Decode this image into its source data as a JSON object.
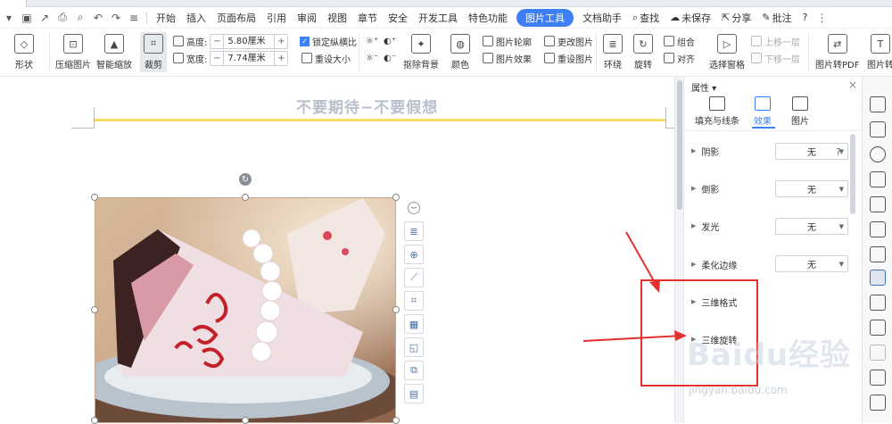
{
  "menubar": {
    "items": [
      "开始",
      "插入",
      "页面布局",
      "引用",
      "审阅",
      "视图",
      "章节",
      "安全",
      "开发工具",
      "特色功能",
      "图片工具",
      "文档助手"
    ],
    "active_tab": "图片工具",
    "search_label": "查找",
    "unsaved_label": "未保存",
    "share_label": "分享",
    "comment_label": "批注",
    "help_label": "?"
  },
  "ribbon": {
    "shape_label": "形状",
    "compress_label": "压缩图片",
    "smart_zoom_label": "智能缩放",
    "crop_label": "裁剪",
    "height_label": "高度:",
    "height_value": "5.80厘米",
    "width_label": "宽度:",
    "width_value": "7.74厘米",
    "lock_ratio_label": "锁定纵横比",
    "reset_size_label": "重设大小",
    "remove_bg_label": "抠除背景",
    "color_label": "颜色",
    "outline_label": "图片轮廓",
    "effect_label": "图片效果",
    "change_pic_label": "更改图片",
    "reset_pic_label": "重设图片",
    "wrap_label": "环绕",
    "rotate_label": "旋转",
    "align_label": "对齐",
    "group_label": "组合",
    "select_pane_label": "选择窗格",
    "up_layer_label": "上移一层",
    "down_layer_label": "下移一层",
    "to_pdf_label": "图片转PDF",
    "to_text_label": "图片转"
  },
  "document": {
    "header_text": "不要期待−不要假想"
  },
  "panel": {
    "title": "属性",
    "tabs": [
      "填充与线条",
      "效果",
      "图片"
    ],
    "active_tab": "效果",
    "rows": [
      {
        "label": "阴影",
        "value": "无"
      },
      {
        "label": "倒影",
        "value": "无"
      },
      {
        "label": "发光",
        "value": "无"
      },
      {
        "label": "柔化边缘",
        "value": "无"
      },
      {
        "label": "三维格式",
        "value": ""
      },
      {
        "label": "三维旋转",
        "value": ""
      }
    ]
  },
  "watermark": {
    "brand": "Baidu经验",
    "url": "jingyan.baidu.com"
  },
  "colors": {
    "accent": "#3d7ff4",
    "highlight_box": "#e53030",
    "header_line": "#f5dd64"
  }
}
